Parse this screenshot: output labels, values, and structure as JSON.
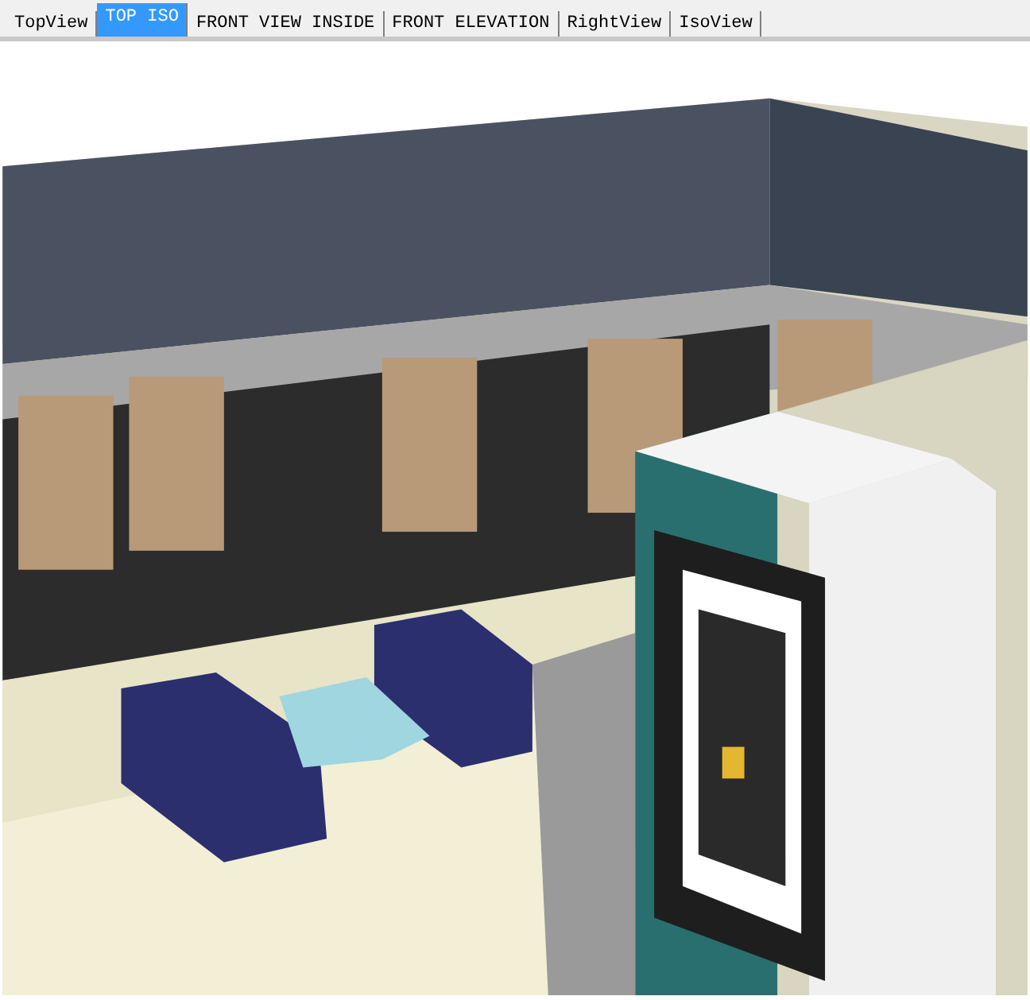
{
  "tabs": [
    {
      "label": "TopView",
      "selected": false
    },
    {
      "label": "TOP ISO",
      "selected": true
    },
    {
      "label": "FRONT VIEW INSIDE",
      "selected": false
    },
    {
      "label": "FRONT ELEVATION",
      "selected": false
    },
    {
      "label": "RightView",
      "selected": false
    },
    {
      "label": "IsoView",
      "selected": false
    }
  ]
}
